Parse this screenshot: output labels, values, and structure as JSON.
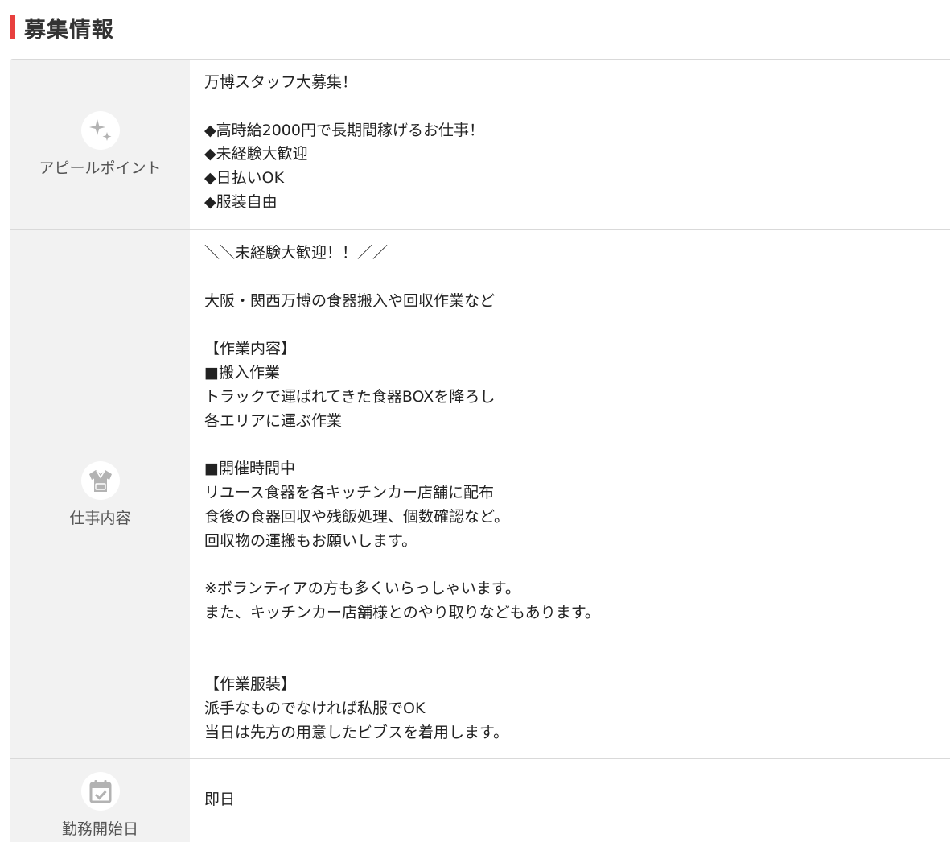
{
  "section": {
    "title": "募集情報"
  },
  "rows": [
    {
      "label": "アピールポイント",
      "icon": "sparkle-icon",
      "content": "万博スタッフ大募集！\n\n◆高時給2000円で長期間稼げるお仕事！\n◆未経験大歓迎\n◆日払いOK\n◆服装自由"
    },
    {
      "label": "仕事内容",
      "icon": "shirt-icon",
      "content": "＼＼未経験大歓迎！！／／\n\n大阪・関西万博の食器搬入や回収作業など\n\n【作業内容】\n■搬入作業\nトラックで運ばれてきた食器BOXを降ろし\n各エリアに運ぶ作業\n\n■開催時間中\nリユース食器を各キッチンカー店舗に配布\n食後の食器回収や残飯処理、個数確認など。\n回収物の運搬もお願いします。\n\n※ボランティアの方も多くいらっしゃいます。\nまた、キッチンカー店舗様とのやり取りなどもあります。\n\n\n【作業服装】\n派手なものでなければ私服でOK\n当日は先方の用意したビブスを着用します。"
    },
    {
      "label": "勤務開始日",
      "icon": "calendar-check-icon",
      "content": "即日"
    }
  ],
  "colors": {
    "accent": "#e8403e",
    "label_bg": "#f2f2f2",
    "border": "#d9d9d9",
    "icon": "#b3b3b3"
  }
}
